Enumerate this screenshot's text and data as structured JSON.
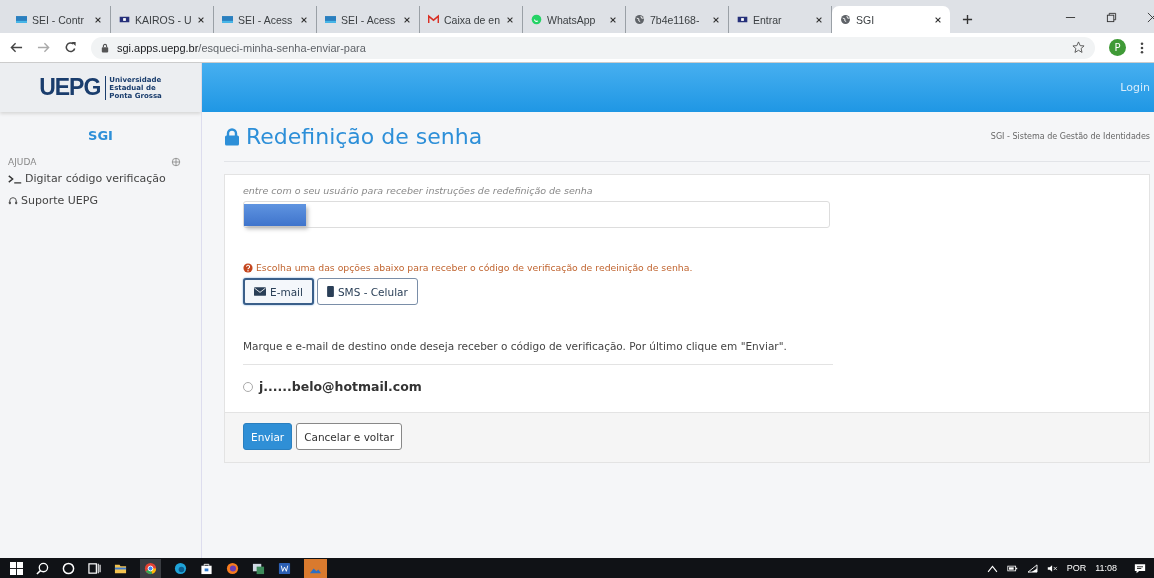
{
  "browser": {
    "tabs": [
      {
        "title": "SEI - Contr",
        "kind": "sei",
        "selected": false
      },
      {
        "title": "KAIROS - U",
        "kind": "university",
        "selected": false
      },
      {
        "title": "SEI - Acess",
        "kind": "sei",
        "selected": false
      },
      {
        "title": "SEI - Acess",
        "kind": "sei",
        "selected": false
      },
      {
        "title": "Caixa de en",
        "kind": "mail",
        "selected": false
      },
      {
        "title": "WhatsApp",
        "kind": "chat",
        "selected": false
      },
      {
        "title": "7b4e1168-",
        "kind": "globe",
        "selected": false
      },
      {
        "title": "Entrar",
        "kind": "university",
        "selected": false
      },
      {
        "title": "SGI",
        "kind": "globe",
        "selected": true
      }
    ],
    "url": {
      "host": "sgi.apps.uepg.br",
      "path": "/esqueci-minha-senha-enviar-para"
    },
    "profile": "P"
  },
  "logo": {
    "mark": "UEPG",
    "lines": [
      "Universidade",
      "Estadual de",
      "Ponta Grossa"
    ]
  },
  "topbar": {
    "login": "Login"
  },
  "sidebar": {
    "title": "SGI",
    "section": "AJUDA",
    "items": [
      {
        "kind": "terminal",
        "label": "Digitar código verificação"
      },
      {
        "kind": "support",
        "label": "Suporte UEPG"
      }
    ]
  },
  "page": {
    "title": "Redefinição de senha",
    "subtitle": "SGI - Sistema de Gestão de Identidades"
  },
  "form": {
    "hint": "entre com o seu usuário para receber instruções de redefinição de senha",
    "username": {
      "redacted": true
    },
    "warning": "Escolha uma das opções abaixo para receber o código de verificação de redeinição de senha.",
    "methods": [
      {
        "label": "E-mail",
        "kind": "email",
        "selected": true
      },
      {
        "label": "SMS - Celular",
        "kind": "sms",
        "selected": false
      }
    ],
    "instruction": "Marque e e-mail de destino onde deseja receber o código de verificação. Por último clique em \"Enviar\".",
    "emails": [
      {
        "label": "j......belo@hotmail.com",
        "selected": false
      }
    ],
    "buttons": [
      {
        "label": "Enviar",
        "kind": "primary"
      },
      {
        "label": "Cancelar e voltar",
        "kind": "default"
      }
    ]
  },
  "taskbar": {
    "apps": [
      {
        "kind": "start"
      },
      {
        "kind": "search"
      },
      {
        "kind": "assistant"
      },
      {
        "kind": "taskview"
      },
      {
        "kind": "folder"
      },
      {
        "kind": "chrome"
      },
      {
        "kind": "edge"
      },
      {
        "kind": "store"
      },
      {
        "kind": "firefox"
      },
      {
        "kind": "app"
      },
      {
        "kind": "word"
      },
      {
        "kind": "photos"
      }
    ],
    "language": "POR",
    "time": "11:08"
  }
}
